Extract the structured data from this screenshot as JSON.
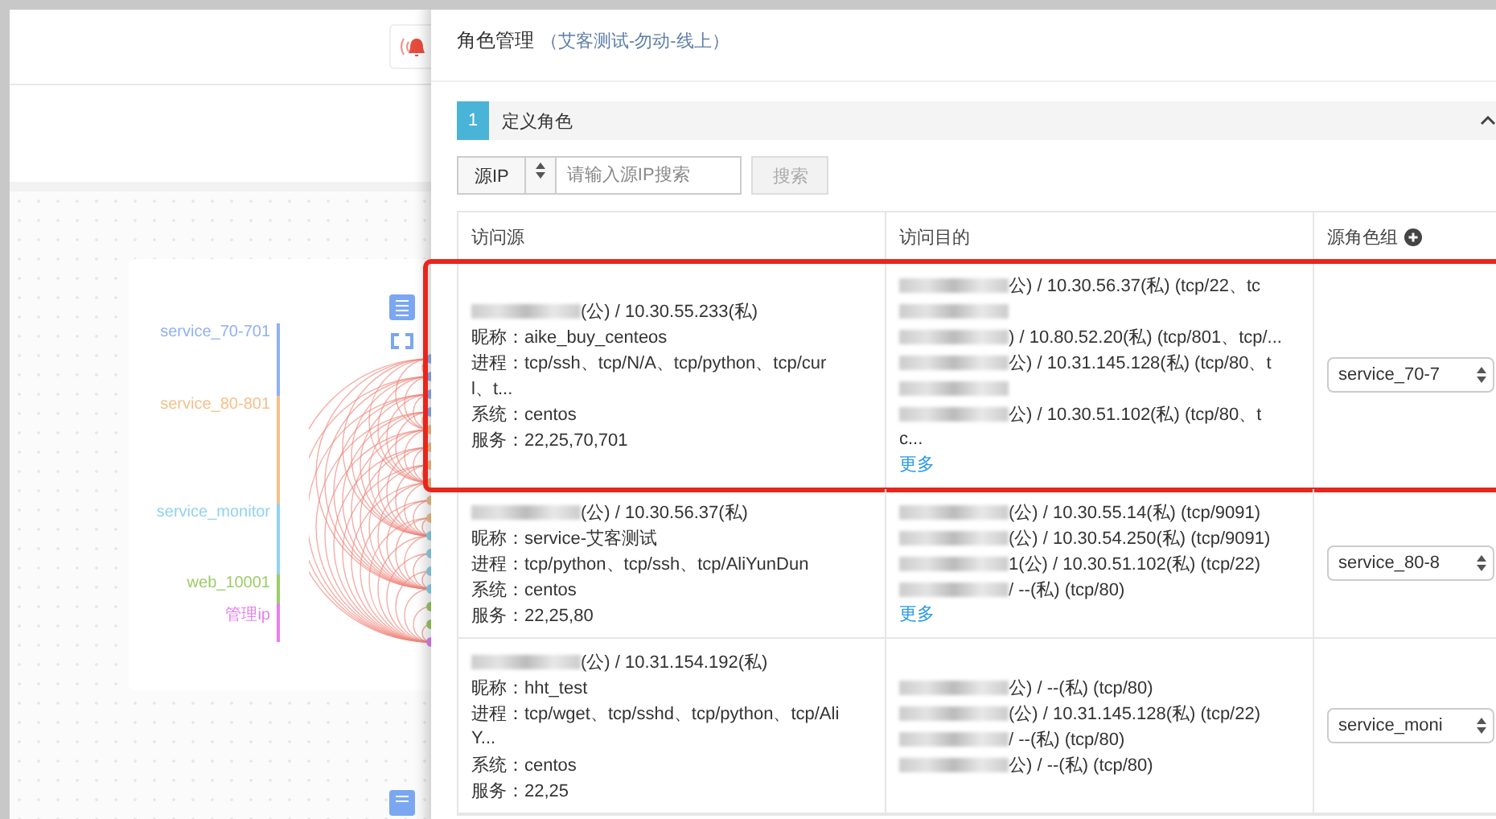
{
  "background": {
    "groups": [
      {
        "label": "service_70-701",
        "color": "#8fb0f5"
      },
      {
        "label": "service_80-801",
        "color": "#f5c08a"
      },
      {
        "label": "service_monitor",
        "color": "#8fd3f0"
      },
      {
        "label": "web_10001",
        "color": "#9ccc65"
      },
      {
        "label": "管理ip",
        "color": "#e57ef0"
      }
    ]
  },
  "dialog": {
    "title": "角色管理",
    "subtitle": "（艾客测试-勿动-线上）",
    "section": {
      "number": "1",
      "title": "定义角色",
      "expanded": true
    },
    "filter": {
      "type": "源IP",
      "placeholder": "请输入源IP搜索",
      "button": "搜索"
    },
    "table": {
      "columns": [
        "访问源",
        "访问目的",
        "源角色组"
      ],
      "rows": [
        {
          "highlighted": true,
          "source": [
            {
              "redacted": true,
              "text": "(公) / 10.30.55.233(私)"
            },
            {
              "redacted": false,
              "text": "昵称：aike_buy_centeos"
            },
            {
              "redacted": false,
              "text": "进程：tcp/ssh、tcp/N/A、tcp/python、tcp/cur"
            },
            {
              "redacted": false,
              "text": "l、t..."
            },
            {
              "redacted": false,
              "text": "系统：centos"
            },
            {
              "redacted": false,
              "text": "服务：22,25,70,701"
            }
          ],
          "dest": [
            {
              "redacted": true,
              "text": "公) / 10.30.56.37(私) (tcp/22、tc"
            },
            {
              "redacted": true
            },
            {
              "redacted": true,
              "text": ") / 10.80.52.20(私) (tcp/801、tcp/..."
            },
            {
              "redacted": true,
              "text": "公) / 10.31.145.128(私) (tcp/80、t"
            },
            {
              "redacted": true
            },
            {
              "redacted": true,
              "text": "公) / 10.30.51.102(私) (tcp/80、t"
            },
            {
              "redacted": false,
              "text": "c..."
            }
          ],
          "more": "更多",
          "group": "service_70-7"
        },
        {
          "highlighted": false,
          "source": [
            {
              "redacted": true,
              "text": "(公) / 10.30.56.37(私)"
            },
            {
              "redacted": false,
              "text": "昵称：service-艾客测试"
            },
            {
              "redacted": false,
              "text": "进程：tcp/python、tcp/ssh、tcp/AliYunDun"
            },
            {
              "redacted": false,
              "text": "系统：centos"
            },
            {
              "redacted": false,
              "text": "服务：22,25,80"
            }
          ],
          "dest": [
            {
              "redacted": true,
              "text": "(公) / 10.30.55.14(私) (tcp/9091)"
            },
            {
              "redacted": true,
              "text": "(公) / 10.30.54.250(私) (tcp/9091)"
            },
            {
              "redacted": true,
              "text": "1(公) / 10.30.51.102(私) (tcp/22)"
            },
            {
              "redacted": true,
              "text": "/ --(私) (tcp/80)"
            }
          ],
          "more": "更多",
          "group": "service_80-8"
        },
        {
          "highlighted": false,
          "source": [
            {
              "redacted": true,
              "text": "(公) / 10.31.154.192(私)"
            },
            {
              "redacted": false,
              "text": "昵称：hht_test"
            },
            {
              "redacted": false,
              "text": "进程：tcp/wget、tcp/sshd、tcp/python、tcp/Ali"
            },
            {
              "redacted": false,
              "text": "Y..."
            },
            {
              "redacted": false,
              "text": "系统：centos"
            },
            {
              "redacted": false,
              "text": "服务：22,25"
            }
          ],
          "dest": [
            {
              "redacted": true,
              "text": "公) / --(私) (tcp/80)"
            },
            {
              "redacted": true,
              "text": "(公) / 10.31.145.128(私) (tcp/22)"
            },
            {
              "redacted": true,
              "text": "/ --(私) (tcp/80)"
            },
            {
              "redacted": true,
              "text": "公) / --(私) (tcp/80)"
            }
          ],
          "group": "service_moni"
        }
      ]
    }
  }
}
